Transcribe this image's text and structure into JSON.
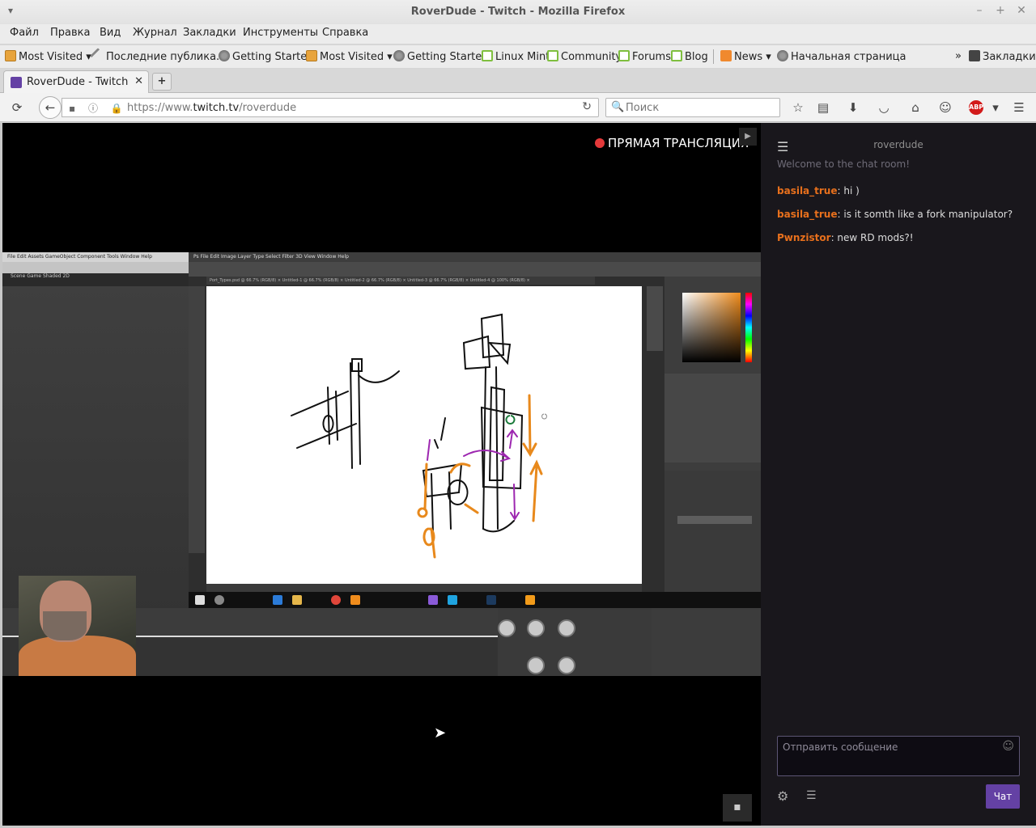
{
  "window": {
    "title": "RoverDude - Twitch - Mozilla Firefox"
  },
  "menu": [
    "Файл",
    "Правка",
    "Вид",
    "Журнал",
    "Закладки",
    "Инструменты",
    "Справка"
  ],
  "bookmarks": {
    "items": [
      "Most Visited",
      "Последние публика...",
      "Getting Started",
      "Most Visited",
      "Getting Started",
      "Linux Mint",
      "Community",
      "Forums",
      "Blog",
      "News",
      "Начальная страница"
    ],
    "overflow": "»",
    "bookmarks_menu": "Закладки"
  },
  "tab": {
    "label": "RoverDude - Twitch",
    "close": "✕",
    "new": "+"
  },
  "nav": {
    "url_prefix": "https://www.",
    "url_host": "twitch.tv",
    "url_path": "/roverdude",
    "search_placeholder": "Поиск",
    "abp": "ABP"
  },
  "player": {
    "live_label": "ПРЯМАЯ ТРАНСЛЯЦИЯ",
    "video": {
      "unity_menu": "File  Edit  Assets  GameObject  Component  Tools  Window  Help",
      "unity_scene": "Scene   Game   Shaded   2D",
      "ps_menu": "Ps   File   Edit   Image   Layer   Type   Select   Filter   3D   View   Window   Help",
      "ps_tabs": "Port_Types.psd @ 66.7% (RGB/8)  ×   Untitled-1 @ 66.7% (RGB/8)  ×   Untitled-2 @ 66.7% (RGB/8)  ×   Untitled-3 @ 66.7% (RGB/8)  ×   Untitled-4 @ 100% (RGB/8)  ×"
    }
  },
  "chat": {
    "channel": "roverdude",
    "welcome": "Welcome to the chat room!",
    "messages": [
      {
        "user": "basila_true",
        "text": "hi )"
      },
      {
        "user": "basila_true",
        "text": "is it somth like a fork manipulator?"
      },
      {
        "user": "Pwnzistor",
        "text": "new RD mods?!"
      }
    ],
    "input_placeholder": "Отправить сообщение",
    "send_label": "Чат"
  },
  "colors": {
    "twitch_purple": "#6441a4",
    "username": "#e8701c",
    "live_dot": "#e4393a"
  }
}
